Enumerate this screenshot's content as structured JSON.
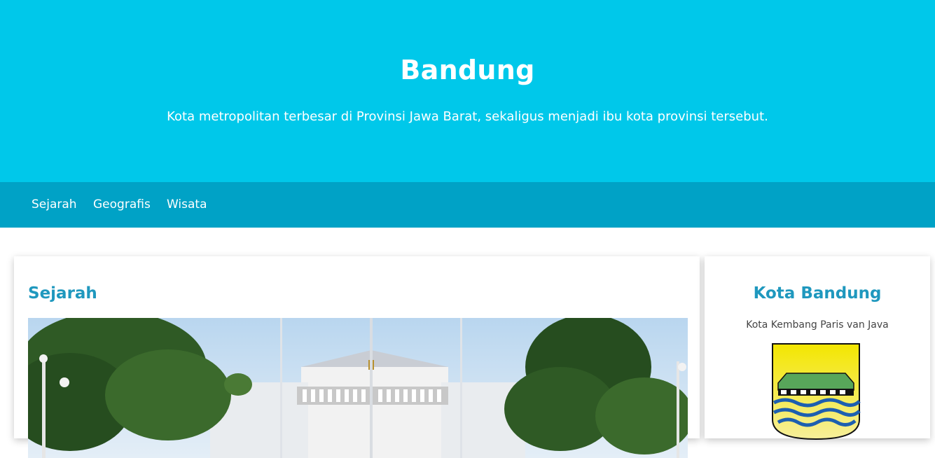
{
  "header": {
    "title": "Bandung",
    "subtitle": "Kota metropolitan terbesar di Provinsi Jawa Barat, sekaligus menjadi ibu kota provinsi tersebut."
  },
  "nav": {
    "items": [
      {
        "label": "Sejarah"
      },
      {
        "label": "Geografis"
      },
      {
        "label": "Wisata"
      }
    ]
  },
  "main": {
    "section_title": "Sejarah",
    "image_icon": "gedung-sate-photo"
  },
  "aside": {
    "title": "Kota Bandung",
    "subtitle": "Kota Kembang Paris van Java",
    "image_icon": "bandung-coat-of-arms"
  },
  "colors": {
    "hero_bg": "#00c8ea",
    "nav_bg": "#00a2c6",
    "heading": "#1f98be"
  }
}
